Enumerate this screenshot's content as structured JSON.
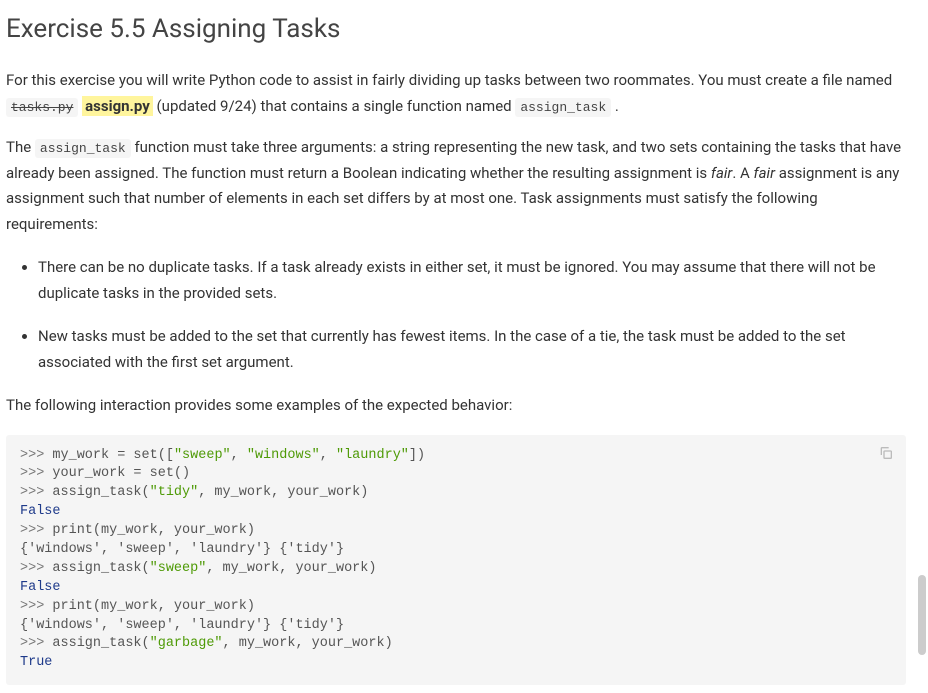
{
  "heading": "Exercise 5.5 Assigning Tasks",
  "p1_a": "For this exercise you will write Python code to assist in fairly dividing up tasks between two roommates. You must create a file named ",
  "tasks_py": "tasks.py",
  "assign_py": "assign.py",
  "p1_b": " (updated 9/24) that contains a single function named ",
  "assign_task_code": "assign_task",
  "p1_c": ".",
  "p2_a": "The ",
  "p2_b": " function must take three arguments: a string representing the new task, and two sets containing the tasks that have already been assigned. The function must return a Boolean indicating whether the resulting assignment is ",
  "fair1": "fair",
  "p2_c": ". A ",
  "fair2": "fair",
  "p2_d": " assignment is any assignment such that number of elements in each set differs by at most one. Task assignments must satisfy the following requirements:",
  "li1": "There can be no duplicate tasks. If a task already exists in either set, it must be ignored. You may assume that there will not be duplicate tasks in the provided sets.",
  "li2": "New tasks must be added to the set that currently has fewest items. In the case of a tie, the task must be added to the set associated with the first set argument.",
  "p3": "The following interaction provides some examples of the expected behavior:",
  "code": {
    "l1_a": ">>> ",
    "l1_b": "my_work = set([",
    "l1_s1": "\"sweep\"",
    "l1_c": ", ",
    "l1_s2": "\"windows\"",
    "l1_d": ", ",
    "l1_s3": "\"laundry\"",
    "l1_e": "])",
    "l2_a": ">>> ",
    "l2_b": "your_work = set()",
    "l3_a": ">>> ",
    "l3_b": "assign_task(",
    "l3_s": "\"tidy\"",
    "l3_c": ", my_work, your_work)",
    "l4": "False",
    "l5_a": ">>> ",
    "l5_b": "print(my_work, your_work)",
    "l6": "{'windows', 'sweep', 'laundry'} {'tidy'}",
    "l7_a": ">>> ",
    "l7_b": "assign_task(",
    "l7_s": "\"sweep\"",
    "l7_c": ", my_work, your_work)",
    "l8": "False",
    "l9_a": ">>> ",
    "l9_b": "print(my_work, your_work)",
    "l10": "{'windows', 'sweep', 'laundry'} {'tidy'}",
    "l11_a": ">>> ",
    "l11_b": "assign_task(",
    "l11_s": "\"garbage\"",
    "l11_c": ", my_work, your_work)",
    "l12": "True"
  }
}
